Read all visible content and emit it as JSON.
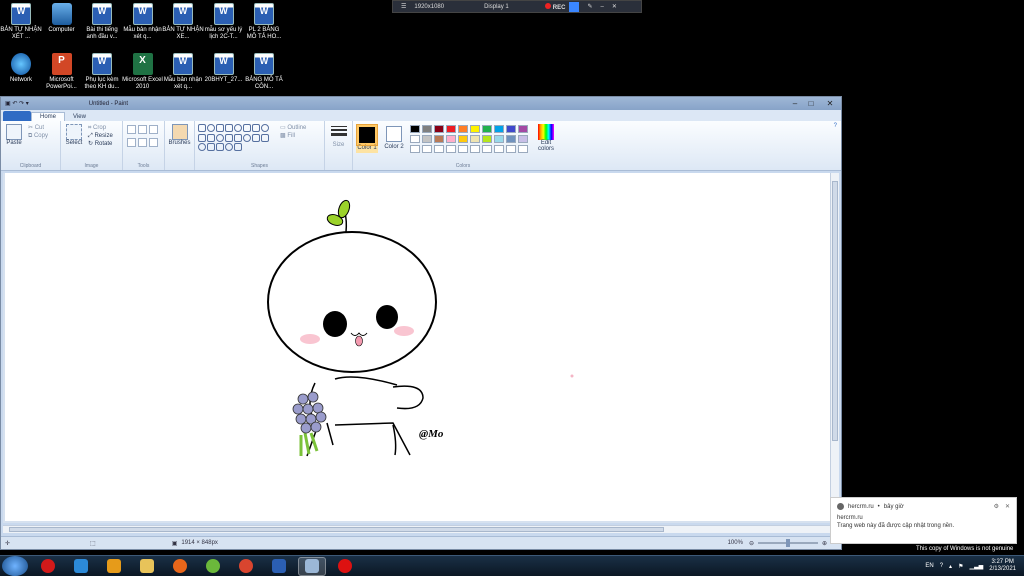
{
  "desktop": {
    "icons_row1": [
      {
        "label": "BẢN TỰ NHẬN XÉT ...",
        "icon": "word-doc-icon"
      },
      {
        "label": "Computer",
        "icon": "computer-icon"
      },
      {
        "label": "Bài thi tiếng anh đầu v...",
        "icon": "word-doc-icon"
      },
      {
        "label": "Mẫu bản nhận xét q...",
        "icon": "word-doc-icon"
      },
      {
        "label": "BẢN TỰ NHẬN XE...",
        "icon": "word-doc-icon"
      },
      {
        "label": "mẫu sơ yếu lý lịch 2C-T...",
        "icon": "word-doc-icon"
      },
      {
        "label": "PL 2 BẢNG MÔ TẢ HO...",
        "icon": "word-doc-icon"
      }
    ],
    "icons_row2": [
      {
        "label": "Network",
        "icon": "network-icon"
      },
      {
        "label": "Microsoft PowerPoi...",
        "icon": "powerpoint-icon"
      },
      {
        "label": "Phụ lục kèm theo KH du...",
        "icon": "word-doc-icon"
      },
      {
        "label": "Microsoft Excel 2010",
        "icon": "excel-icon"
      },
      {
        "label": "Mẫu bản nhận xét q...",
        "icon": "word-doc-icon"
      },
      {
        "label": "20BHYT_27...",
        "icon": "word-doc-icon"
      },
      {
        "label": "BẢNG MÔ TẢ CÔN...",
        "icon": "word-doc-icon"
      }
    ]
  },
  "recorder": {
    "resolution": "1920x1080",
    "display": "Display 1",
    "rec_label": "REC"
  },
  "paint": {
    "title": "Untitled - Paint",
    "tabs": [
      "Home",
      "View"
    ],
    "clipboard": {
      "paste": "Paste",
      "cut": "Cut",
      "copy": "Copy",
      "label": "Clipboard"
    },
    "image": {
      "select": "Select",
      "crop": "Crop",
      "resize": "Resize",
      "rotate": "Rotate",
      "label": "Image"
    },
    "tools_label": "Tools",
    "brushes": "Brushes",
    "shapes": {
      "outline": "Outline",
      "fill": "Fill",
      "label": "Shapes"
    },
    "size": "Size",
    "color1": "Color 1",
    "color2": "Color 2",
    "colors_label": "Colors",
    "edit_colors": "Edit colors",
    "palette": [
      "#000000",
      "#7f7f7f",
      "#880015",
      "#ed1c24",
      "#ff7f27",
      "#fff200",
      "#22b14c",
      "#00a2e8",
      "#3f48cc",
      "#a349a4",
      "#ffffff",
      "#c3c3c3",
      "#b97a57",
      "#ffaec9",
      "#ffc90e",
      "#efe4b0",
      "#b5e61d",
      "#99d9ea",
      "#7092be",
      "#c8bfe7",
      "#ffffff",
      "#ffffff",
      "#ffffff",
      "#ffffff",
      "#ffffff",
      "#ffffff",
      "#ffffff",
      "#ffffff",
      "#ffffff",
      "#ffffff"
    ],
    "drawing_signature": "@Mo",
    "status": {
      "size": "1914 × 848px",
      "zoom": "100%"
    }
  },
  "notification": {
    "site": "hercrm.ru",
    "time": "bây giờ",
    "origin": "hercrm.ru",
    "message": "Trang web này đã được cập nhật trong nền."
  },
  "genuine_notice": "This copy of Windows is not genuine",
  "taskbar": {
    "apps": [
      "opera-icon",
      "ie-icon",
      "media-player-icon",
      "explorer-icon",
      "firefox-icon",
      "app-green-icon",
      "chrome-icon",
      "word-icon",
      "paint-icon",
      "recorder-icon"
    ],
    "lang": "EN",
    "time": "3:27 PM",
    "date": "2/13/2021"
  }
}
